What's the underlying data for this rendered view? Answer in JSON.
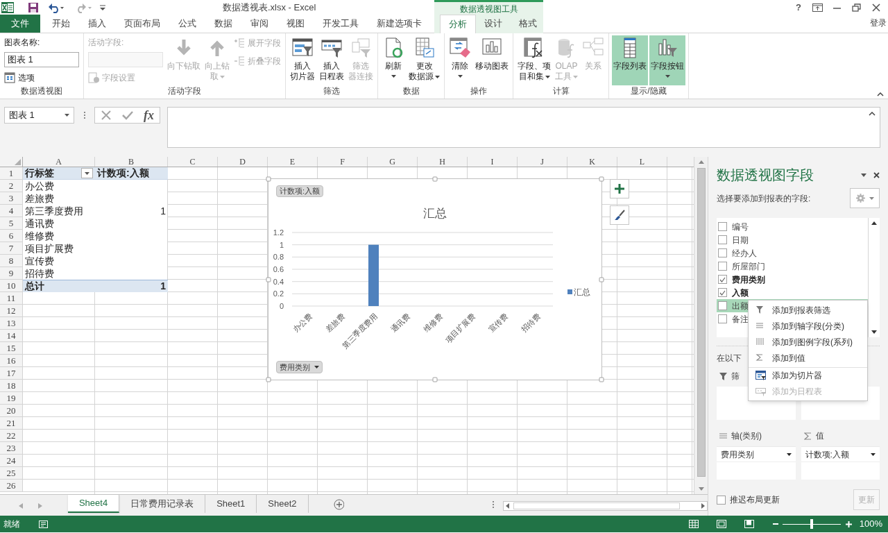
{
  "title_bar": {
    "title": "数据透视表.xlsx - Excel",
    "context_label": "数据透视图工具",
    "help": "?"
  },
  "ribbon_tabs": [
    {
      "label": "文件",
      "kind": "file",
      "selected": false
    },
    {
      "label": "开始",
      "kind": "normal",
      "selected": false
    },
    {
      "label": "插入",
      "kind": "normal",
      "selected": false
    },
    {
      "label": "页面布局",
      "kind": "normal",
      "selected": false
    },
    {
      "label": "公式",
      "kind": "normal",
      "selected": false
    },
    {
      "label": "数据",
      "kind": "normal",
      "selected": false
    },
    {
      "label": "审阅",
      "kind": "normal",
      "selected": false
    },
    {
      "label": "视图",
      "kind": "normal",
      "selected": false
    },
    {
      "label": "开发工具",
      "kind": "normal",
      "selected": false
    },
    {
      "label": "新建选项卡",
      "kind": "normal",
      "selected": false
    },
    {
      "label": "分析",
      "kind": "context",
      "selected": true
    },
    {
      "label": "设计",
      "kind": "context",
      "selected": false
    },
    {
      "label": "格式",
      "kind": "context",
      "selected": false
    }
  ],
  "account": "登录",
  "ribbon_groups": [
    {
      "label": "数据透视图",
      "items": [
        {
          "kind": "label",
          "label": "图表名称:",
          "disabled": false
        },
        {
          "kind": "field",
          "value": "图表 1",
          "disabled": false
        },
        {
          "kind": "small",
          "label": "选项",
          "disabled": false
        }
      ]
    },
    {
      "label": "活动字段",
      "items": [
        {
          "kind": "label",
          "label": "活动字段:",
          "disabled": true
        },
        {
          "kind": "field",
          "disabled": true
        },
        {
          "kind": "small",
          "label": "字段设置",
          "disabled": true
        },
        {
          "kind": "large",
          "lines": [
            "向下钻取"
          ],
          "disabled": true,
          "dropdown": false,
          "on": false
        },
        {
          "kind": "large",
          "lines": [
            "向上钻",
            "取"
          ],
          "disabled": true,
          "dropdown": true,
          "on": false
        },
        {
          "kind": "small",
          "label": "展开字段",
          "disabled": true
        },
        {
          "kind": "small",
          "label": "折叠字段",
          "disabled": true
        }
      ]
    },
    {
      "label": "筛选",
      "items": [
        {
          "kind": "large",
          "lines": [
            "插入",
            "切片器"
          ],
          "disabled": false,
          "dropdown": false,
          "on": false
        },
        {
          "kind": "large",
          "lines": [
            "插入",
            "日程表"
          ],
          "disabled": false,
          "dropdown": false,
          "on": false
        },
        {
          "kind": "large",
          "lines": [
            "筛选",
            "器连接"
          ],
          "disabled": true,
          "dropdown": false,
          "on": false
        }
      ]
    },
    {
      "label": "数据",
      "items": [
        {
          "kind": "large",
          "lines": [
            "刷新"
          ],
          "disabled": false,
          "dropdown": true,
          "on": false
        },
        {
          "kind": "large",
          "lines": [
            "更改",
            "数据源"
          ],
          "disabled": false,
          "dropdown": true,
          "on": false
        }
      ]
    },
    {
      "label": "操作",
      "items": [
        {
          "kind": "large",
          "lines": [
            "清除"
          ],
          "disabled": false,
          "dropdown": true,
          "on": false
        },
        {
          "kind": "large",
          "lines": [
            "移动图表"
          ],
          "disabled": false,
          "dropdown": false,
          "on": false
        }
      ]
    },
    {
      "label": "计算",
      "items": [
        {
          "kind": "large",
          "lines": [
            "字段、项",
            "目和集"
          ],
          "disabled": false,
          "dropdown": true,
          "on": false
        },
        {
          "kind": "large",
          "lines": [
            "OLAP",
            "工具"
          ],
          "disabled": true,
          "dropdown": true,
          "on": false
        },
        {
          "kind": "large",
          "lines": [
            "关系"
          ],
          "disabled": true,
          "dropdown": false,
          "on": false
        }
      ]
    },
    {
      "label": "显示/隐藏",
      "items": [
        {
          "kind": "large",
          "lines": [
            "字段列表"
          ],
          "disabled": false,
          "dropdown": false,
          "on": true
        },
        {
          "kind": "large",
          "lines": [
            "字段按钮"
          ],
          "disabled": false,
          "dropdown": true,
          "on": true
        }
      ]
    }
  ],
  "formula_bar": {
    "name_box": "图表 1",
    "function_label": "fx"
  },
  "columns": [
    "A",
    "B",
    "C",
    "D",
    "E",
    "F",
    "G",
    "H",
    "I",
    "J",
    "K",
    "L"
  ],
  "rows": [
    {
      "number": "1",
      "kind": "header",
      "cells": [
        "行标签",
        "计数项:入额"
      ]
    },
    {
      "number": "2",
      "kind": "item",
      "cells": [
        "办公费"
      ]
    },
    {
      "number": "3",
      "kind": "item",
      "cells": [
        "差旅费"
      ]
    },
    {
      "number": "4",
      "kind": "item",
      "cells": [
        "第三季度费用",
        "1"
      ]
    },
    {
      "number": "5",
      "kind": "item",
      "cells": [
        "通讯费"
      ]
    },
    {
      "number": "6",
      "kind": "item",
      "cells": [
        "维修费"
      ]
    },
    {
      "number": "7",
      "kind": "item",
      "cells": [
        "项目扩展费"
      ]
    },
    {
      "number": "8",
      "kind": "item",
      "cells": [
        "宣传费"
      ]
    },
    {
      "number": "9",
      "kind": "item",
      "cells": [
        "招待费"
      ]
    },
    {
      "number": "10",
      "kind": "total",
      "cells": [
        "总计",
        "1"
      ]
    },
    {
      "number": "11",
      "kind": "plain"
    },
    {
      "number": "12",
      "kind": "plain"
    },
    {
      "number": "13",
      "kind": "plain"
    },
    {
      "number": "14",
      "kind": "plain"
    },
    {
      "number": "15",
      "kind": "plain"
    },
    {
      "number": "16",
      "kind": "plain"
    },
    {
      "number": "17",
      "kind": "plain"
    },
    {
      "number": "18",
      "kind": "plain"
    },
    {
      "number": "19",
      "kind": "plain"
    },
    {
      "number": "20",
      "kind": "plain"
    },
    {
      "number": "21",
      "kind": "plain"
    },
    {
      "number": "22",
      "kind": "plain"
    },
    {
      "number": "23",
      "kind": "plain"
    },
    {
      "number": "24",
      "kind": "plain"
    },
    {
      "number": "25",
      "kind": "plain"
    },
    {
      "number": "26",
      "kind": "plain"
    }
  ],
  "chart": {
    "value_field_button": "计数项:入额",
    "axis_field_button": "费用类别",
    "chart_data": {
      "type": "bar",
      "title": "汇总",
      "categories": [
        "办公费",
        "差旅费",
        "第三季度费用",
        "通讯费",
        "维修费",
        "项目扩展费",
        "宣传费",
        "招待费"
      ],
      "series": [
        {
          "name": "汇总",
          "color": "#4f81bd",
          "values": [
            null,
            null,
            1,
            null,
            null,
            null,
            null,
            null
          ]
        }
      ],
      "ylim": [
        0,
        1.2
      ],
      "grid": true,
      "yticks": [
        0,
        0.2,
        0.4,
        0.6,
        0.8,
        1,
        1.2
      ]
    }
  },
  "sheet_tabs": [
    {
      "label": "Sheet4",
      "selected": true
    },
    {
      "label": "日常费用记录表",
      "selected": false
    },
    {
      "label": "Sheet1",
      "selected": false
    },
    {
      "label": "Sheet2",
      "selected": false
    }
  ],
  "field_pane": {
    "title": "数据透视图字段",
    "subtitle": "选择要添加到报表的字段:",
    "fields": [
      {
        "label": "编号",
        "checked": false,
        "selected": false
      },
      {
        "label": "日期",
        "checked": false,
        "selected": false
      },
      {
        "label": "经办人",
        "checked": false,
        "selected": false
      },
      {
        "label": "所屋部门",
        "checked": false,
        "selected": false
      },
      {
        "label": "费用类别",
        "checked": true,
        "selected": false
      },
      {
        "label": "入额",
        "checked": true,
        "selected": false
      },
      {
        "label": "出额",
        "checked": false,
        "selected": true
      },
      {
        "label": "备注",
        "checked": false,
        "selected": false
      }
    ],
    "context_menu": [
      {
        "label": "添加到报表筛选",
        "disabled": false,
        "separator_above": false
      },
      {
        "label": "添加到轴字段(分类)",
        "disabled": false,
        "separator_above": false
      },
      {
        "label": "添加到图例字段(系列)",
        "disabled": false,
        "separator_above": false
      },
      {
        "label": "添加到值",
        "disabled": false,
        "separator_above": false
      },
      {
        "label": "添加为切片器",
        "disabled": false,
        "separator_above": true
      },
      {
        "label": "添加为日程表",
        "disabled": true,
        "separator_above": false
      }
    ],
    "areas_hint": "在以下",
    "areas": [
      {
        "kind": "filter",
        "label": "筛"
      },
      {
        "kind": "columns"
      },
      {
        "kind": "axis",
        "label": "轴(类别)",
        "items": [
          "费用类别"
        ]
      },
      {
        "kind": "values",
        "label": "值",
        "items": [
          "计数项:入额"
        ]
      }
    ],
    "defer_update": {
      "label": "推迟布局更新",
      "checked": false
    },
    "update_button": {
      "label": "更新",
      "disabled": true
    }
  },
  "status_bar": {
    "status": "就绪",
    "zoom": "100%",
    "zoom_slider": {
      "level": 0.5
    }
  }
}
